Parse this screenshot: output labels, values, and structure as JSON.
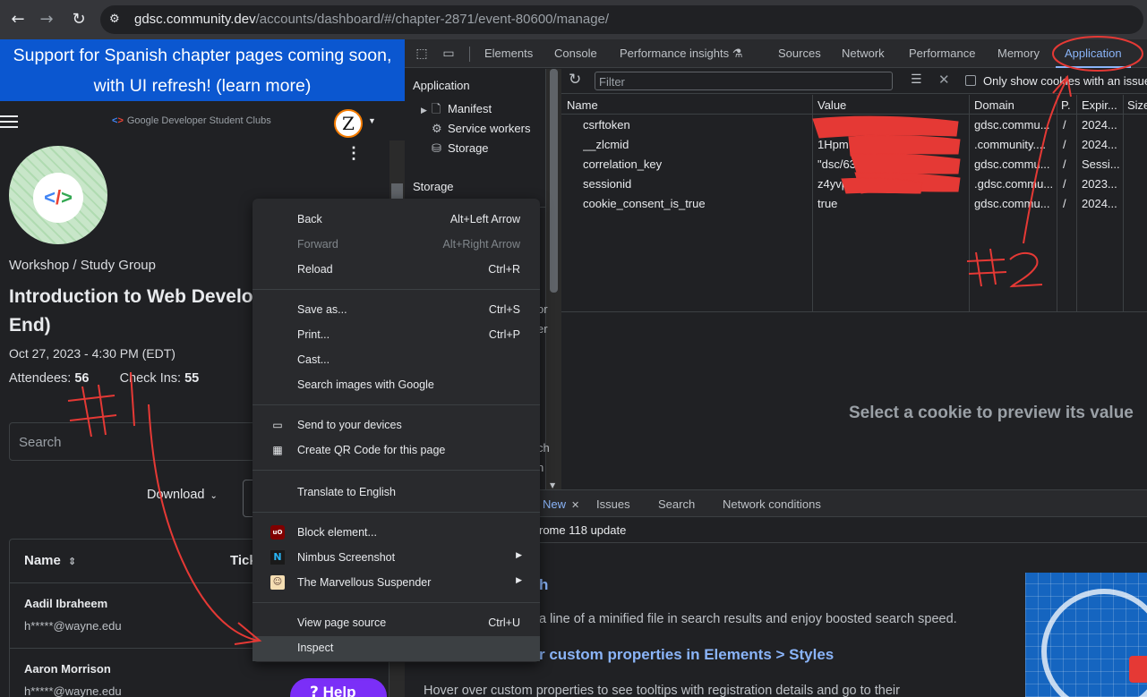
{
  "browser": {
    "url_host": "gdsc.community.dev",
    "url_path": "/accounts/dashboard/#/chapter-2871/event-80600/manage/",
    "back_icon": "arrow-left-icon",
    "forward_icon": "arrow-right-icon",
    "reload_icon": "reload-icon"
  },
  "page": {
    "banner_line1": "Support for Spanish chapter pages coming soon,",
    "banner_line2": "with UI refresh! (learn more)",
    "logo_text": "Google Developer Student Clubs",
    "avatar_letter": "Z",
    "event_type": "Workshop / Study Group",
    "title_line1": "Introduction to Web Develo",
    "title_line2": "End)",
    "date": "Oct 27, 2023 - 4:30 PM (EDT)",
    "attendees_label": "Attendees:",
    "attendees_value": "56",
    "checkins_label": "Check Ins:",
    "checkins_value": "55",
    "search_placeholder": "Search",
    "download_label": "Download",
    "table": {
      "col_name": "Name",
      "col_ticket": "Tick",
      "rows": [
        {
          "name": "Aadil Ibraheem",
          "email": "h*****@wayne.edu"
        },
        {
          "name": "Aaron Morrison",
          "email": "h*****@wayne.edu"
        }
      ]
    },
    "help_label": "Help"
  },
  "devtools": {
    "tabs": [
      "Elements",
      "Console",
      "Performance insights",
      "Sources",
      "Network",
      "Performance",
      "Memory",
      "Application"
    ],
    "active_tab": "Application",
    "sidebar": {
      "app_header": "Application",
      "items": [
        "Manifest",
        "Service workers",
        "Storage"
      ],
      "storage_header": "Storage",
      "peek_1": "or",
      "peek_2": "er",
      "peek_3": "ch",
      "peek_4": "n"
    },
    "filter_placeholder": "Filter",
    "only_issues_label": "Only show cookies with an issue",
    "columns": [
      "Name",
      "Value",
      "Domain",
      "P.",
      "Expir...",
      "Size"
    ],
    "cookies": [
      {
        "name": "csrftoken",
        "value": "Tsr",
        "domain": "gdsc.commu...",
        "path": "/",
        "expires": "2024..."
      },
      {
        "name": "__zlcmid",
        "value": "1Hpm",
        "domain": ".community....",
        "path": "/",
        "expires": "2024..."
      },
      {
        "name": "correlation_key",
        "value": "\"dsc/63",
        "domain": "gdsc.commu...",
        "path": "/",
        "expires": "Sessi..."
      },
      {
        "name": "sessionid",
        "value": "z4yvp",
        "domain": ".gdsc.commu...",
        "path": "/",
        "expires": "2023..."
      },
      {
        "name": "cookie_consent_is_true",
        "value": "true",
        "domain": "gdsc.commu...",
        "path": "/",
        "expires": "2024..."
      }
    ],
    "preview_message": "Select a cookie to preview its value",
    "drawer": {
      "tabs": [
        "New",
        "Issues",
        "Search",
        "Network conditions"
      ],
      "active_tab": "New",
      "subheader": "rome 118 update",
      "heading1": "h",
      "para1": "a line of a minified file in search results and enjoy boosted search speed.",
      "heading2": "r custom properties in Elements > Styles",
      "para2": "Hover over custom properties to see tooltips with registration details and go to their"
    }
  },
  "context_menu": {
    "items": [
      {
        "label": "Back",
        "shortcut": "Alt+Left Arrow"
      },
      {
        "label": "Forward",
        "shortcut": "Alt+Right Arrow",
        "disabled": true
      },
      {
        "label": "Reload",
        "shortcut": "Ctrl+R"
      },
      {
        "label": "Save as...",
        "shortcut": "Ctrl+S"
      },
      {
        "label": "Print...",
        "shortcut": "Ctrl+P"
      },
      {
        "label": "Cast..."
      },
      {
        "label": "Search images with Google"
      },
      {
        "label": "Send to your devices",
        "icon": "send-to-devices-icon"
      },
      {
        "label": "Create QR Code for this page",
        "icon": "qr-code-icon"
      },
      {
        "label": "Translate to English"
      },
      {
        "label": "Block element...",
        "icon": "ublock-icon"
      },
      {
        "label": "Nimbus Screenshot",
        "icon": "nimbus-icon"
      },
      {
        "label": "The Marvellous Suspender",
        "icon": "marvellous-suspender-icon"
      },
      {
        "label": "View page source",
        "shortcut": "Ctrl+U"
      },
      {
        "label": "Inspect"
      }
    ]
  },
  "annotations": {
    "label1": "#1",
    "label2": "#2",
    "color": "#e53935"
  },
  "colors": {
    "banner": "#0b57d0",
    "accent": "#8ab4f8",
    "redaction": "#e53935"
  }
}
